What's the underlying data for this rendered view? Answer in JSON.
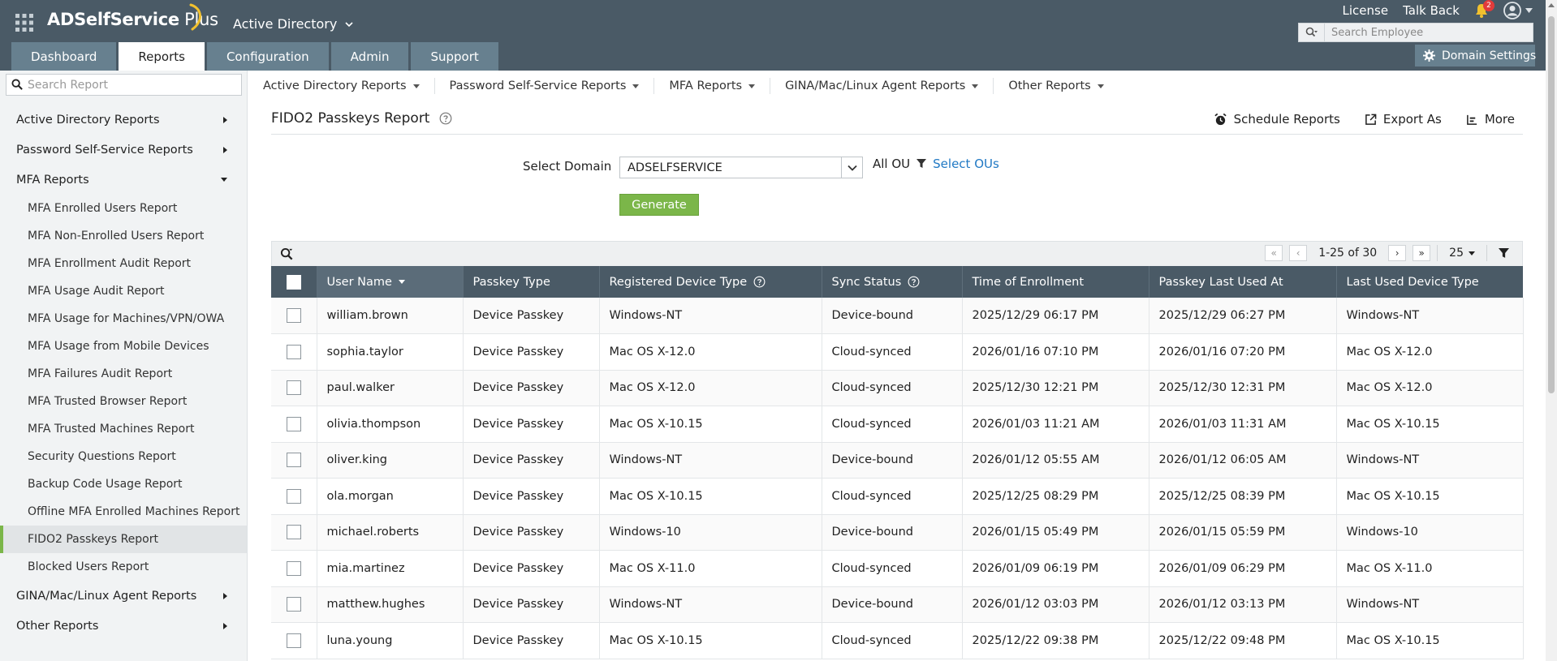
{
  "header": {
    "logo_bold": "ADSelfService",
    "logo_light": " Plus",
    "product": "Active Directory",
    "links": {
      "license": "License",
      "talk_back": "Talk Back"
    },
    "notification_count": "2",
    "search_placeholder": "Search Employee",
    "tabs": [
      {
        "label": "Dashboard",
        "active": false
      },
      {
        "label": "Reports",
        "active": true
      },
      {
        "label": "Configuration",
        "active": false
      },
      {
        "label": "Admin",
        "active": false
      },
      {
        "label": "Support",
        "active": false
      }
    ],
    "domain_settings": "Domain Settings"
  },
  "sidebar": {
    "search_placeholder": "Search Report",
    "categories": [
      {
        "label": "Active Directory Reports",
        "expanded": false
      },
      {
        "label": "Password Self-Service Reports",
        "expanded": false
      },
      {
        "label": "MFA Reports",
        "expanded": true
      },
      {
        "label": "GINA/Mac/Linux Agent Reports",
        "expanded": false
      },
      {
        "label": "Other Reports",
        "expanded": false
      }
    ],
    "mfa_items": [
      "MFA Enrolled Users Report",
      "MFA Non-Enrolled Users Report",
      "MFA Enrollment Audit Report",
      "MFA Usage Audit Report",
      "MFA Usage for Machines/VPN/OWA",
      "MFA Usage from Mobile Devices",
      "MFA Failures Audit Report",
      "MFA Trusted Browser Report",
      "MFA Trusted Machines Report",
      "Security Questions Report",
      "Backup Code Usage Report",
      "Offline MFA Enrolled Machines Report",
      "FIDO2 Passkeys Report",
      "Blocked Users Report"
    ],
    "active_item": "FIDO2 Passkeys Report"
  },
  "subnav": [
    "Active Directory Reports",
    "Password Self-Service Reports",
    "MFA Reports",
    "GINA/Mac/Linux Agent Reports",
    "Other Reports"
  ],
  "report": {
    "title": "FIDO2 Passkeys Report",
    "actions": {
      "schedule": "Schedule Reports",
      "export": "Export As",
      "more": "More"
    },
    "filter": {
      "domain_label": "Select Domain",
      "domain_value": "ADSELFSERVICE",
      "ou_label": "All OU",
      "ou_link": "Select OUs",
      "generate": "Generate"
    },
    "pager": {
      "range": "1-25 of 30",
      "page_size": "25"
    }
  },
  "table": {
    "columns": [
      "User Name",
      "Passkey Type",
      "Registered Device Type",
      "Sync Status",
      "Time of Enrollment",
      "Passkey Last Used At",
      "Last Used Device Type"
    ],
    "rows": [
      [
        "william.brown",
        "Device Passkey",
        "Windows-NT",
        "Device-bound",
        "2025/12/29 06:17 PM",
        "2025/12/29 06:27 PM",
        "Windows-NT"
      ],
      [
        "sophia.taylor",
        "Device Passkey",
        "Mac OS X-12.0",
        "Cloud-synced",
        "2026/01/16 07:10 PM",
        "2026/01/16 07:20 PM",
        "Mac OS X-12.0"
      ],
      [
        "paul.walker",
        "Device Passkey",
        "Mac OS X-12.0",
        "Cloud-synced",
        "2025/12/30 12:21 PM",
        "2025/12/30 12:31 PM",
        "Mac OS X-12.0"
      ],
      [
        "olivia.thompson",
        "Device Passkey",
        "Mac OS X-10.15",
        "Cloud-synced",
        "2026/01/03 11:21 AM",
        "2026/01/03 11:31 AM",
        "Mac OS X-10.15"
      ],
      [
        "oliver.king",
        "Device Passkey",
        "Windows-NT",
        "Device-bound",
        "2026/01/12 05:55 AM",
        "2026/01/12 06:05 AM",
        "Windows-NT"
      ],
      [
        "ola.morgan",
        "Device Passkey",
        "Mac OS X-10.15",
        "Cloud-synced",
        "2025/12/25 08:29 PM",
        "2025/12/25 08:39 PM",
        "Mac OS X-10.15"
      ],
      [
        "michael.roberts",
        "Device Passkey",
        "Windows-10",
        "Device-bound",
        "2026/01/15 05:49 PM",
        "2026/01/15 05:59 PM",
        "Windows-10"
      ],
      [
        "mia.martinez",
        "Device Passkey",
        "Mac OS X-11.0",
        "Cloud-synced",
        "2026/01/09 06:19 PM",
        "2026/01/09 06:29 PM",
        "Mac OS X-11.0"
      ],
      [
        "matthew.hughes",
        "Device Passkey",
        "Windows-NT",
        "Device-bound",
        "2026/01/12 03:03 PM",
        "2026/01/12 03:13 PM",
        "Windows-NT"
      ],
      [
        "luna.young",
        "Device Passkey",
        "Mac OS X-10.15",
        "Cloud-synced",
        "2025/12/22 09:38 PM",
        "2025/12/22 09:48 PM",
        "Mac OS X-10.15"
      ]
    ]
  },
  "colors": {
    "header_bg": "#4a5a66",
    "tab_bg": "#67808f",
    "accent_green": "#7bb649",
    "link_blue": "#2179c4"
  }
}
